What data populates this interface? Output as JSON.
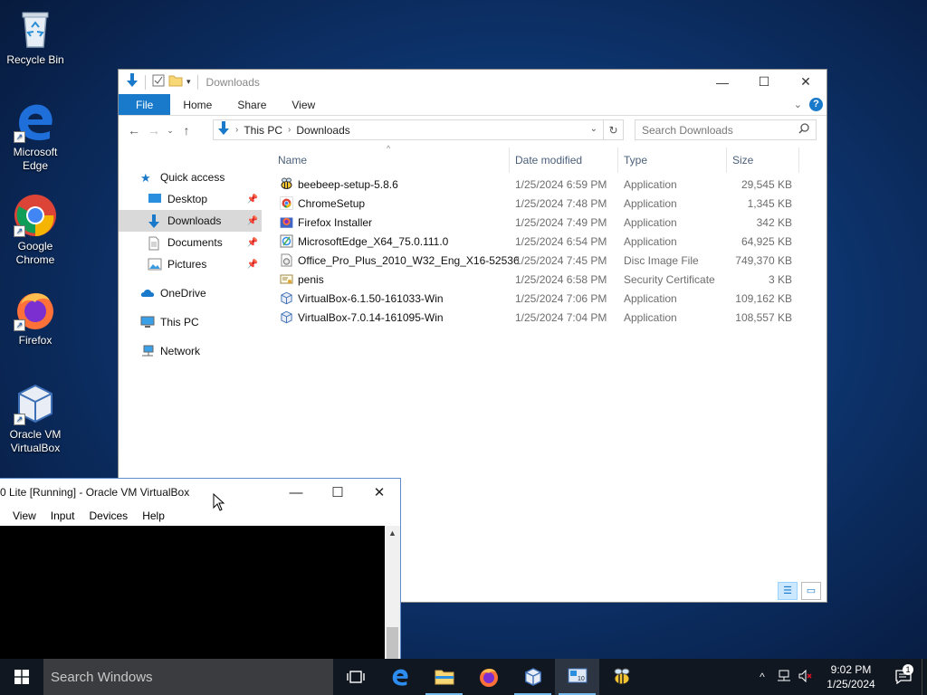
{
  "desktop": {
    "icons": [
      {
        "label_line1": "Recycle Bin",
        "label_line2": ""
      },
      {
        "label_line1": "Microsoft",
        "label_line2": "Edge"
      },
      {
        "label_line1": "Google",
        "label_line2": "Chrome"
      },
      {
        "label_line1": "Firefox",
        "label_line2": ""
      },
      {
        "label_line1": "Oracle VM",
        "label_line2": "VirtualBox"
      }
    ]
  },
  "explorer": {
    "title": "Downloads",
    "ribbon_tabs": [
      "File",
      "Home",
      "Share",
      "View"
    ],
    "breadcrumb": [
      "This PC",
      "Downloads"
    ],
    "search_placeholder": "Search Downloads",
    "nav": {
      "quick_access": "Quick access",
      "items": [
        "Desktop",
        "Downloads",
        "Documents",
        "Pictures"
      ],
      "onedrive": "OneDrive",
      "this_pc": "This PC",
      "network": "Network"
    },
    "columns": [
      "Name",
      "Date modified",
      "Type",
      "Size"
    ],
    "files": [
      {
        "name": "beebeep-setup-5.8.6",
        "date": "1/25/2024 6:59 PM",
        "type": "Application",
        "size": "29,545 KB",
        "icon": "beebeep-icon"
      },
      {
        "name": "ChromeSetup",
        "date": "1/25/2024 7:48 PM",
        "type": "Application",
        "size": "1,345 KB",
        "icon": "chrome-icon"
      },
      {
        "name": "Firefox Installer",
        "date": "1/25/2024 7:49 PM",
        "type": "Application",
        "size": "342 KB",
        "icon": "firefox-icon"
      },
      {
        "name": "MicrosoftEdge_X64_75.0.111.0",
        "date": "1/25/2024 6:54 PM",
        "type": "Application",
        "size": "64,925 KB",
        "icon": "installer-icon"
      },
      {
        "name": "Office_Pro_Plus_2010_W32_Eng_X16-52536",
        "date": "1/25/2024 7:45 PM",
        "type": "Disc Image File",
        "size": "749,370 KB",
        "icon": "disc-image-icon"
      },
      {
        "name": "penis",
        "date": "1/25/2024 6:58 PM",
        "type": "Security Certificate",
        "size": "3 KB",
        "icon": "certificate-icon"
      },
      {
        "name": "VirtualBox-6.1.50-161033-Win",
        "date": "1/25/2024 7:06 PM",
        "type": "Application",
        "size": "109,162 KB",
        "icon": "virtualbox-icon"
      },
      {
        "name": "VirtualBox-7.0.14-161095-Win",
        "date": "1/25/2024 7:04 PM",
        "type": "Application",
        "size": "108,557 KB",
        "icon": "virtualbox-icon"
      }
    ]
  },
  "virtualbox": {
    "title": "0 Lite [Running] - Oracle VM VirtualBox",
    "menu": [
      "View",
      "Input",
      "Devices",
      "Help"
    ]
  },
  "taskbar": {
    "search_placeholder": "Search Windows",
    "time": "9:02 PM",
    "date": "1/25/2024",
    "notification_count": "1"
  },
  "colors": {
    "accent": "#1979ca",
    "taskbar": "#101720"
  }
}
